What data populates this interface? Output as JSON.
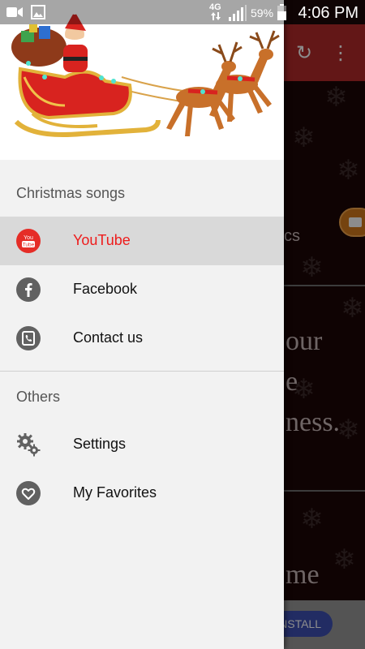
{
  "status_bar": {
    "network": "4G",
    "battery": "59%",
    "time": "4:06 PM"
  },
  "background_app": {
    "text_fragment_1": "cs",
    "text_fragment_2": "our",
    "text_fragment_3": "e",
    "text_fragment_4": "ness.",
    "text_fragment_5": "me",
    "ad_button": "NSTALL"
  },
  "drawer": {
    "sections": [
      {
        "title": "Christmas songs",
        "items": [
          {
            "label": "YouTube",
            "icon": "youtube-icon",
            "active": true
          },
          {
            "label": "Facebook",
            "icon": "facebook-icon",
            "active": false
          },
          {
            "label": "Contact us",
            "icon": "phone-icon",
            "active": false
          }
        ]
      },
      {
        "title": "Others",
        "items": [
          {
            "label": "Settings",
            "icon": "gears-icon",
            "active": false
          },
          {
            "label": "My Favorites",
            "icon": "heart-icon",
            "active": false
          }
        ]
      }
    ]
  },
  "colors": {
    "active_label": "#ee1c1c",
    "toolbar": "#b52a2a",
    "youtube": "#e52d27",
    "icon_gray": "#616161"
  }
}
